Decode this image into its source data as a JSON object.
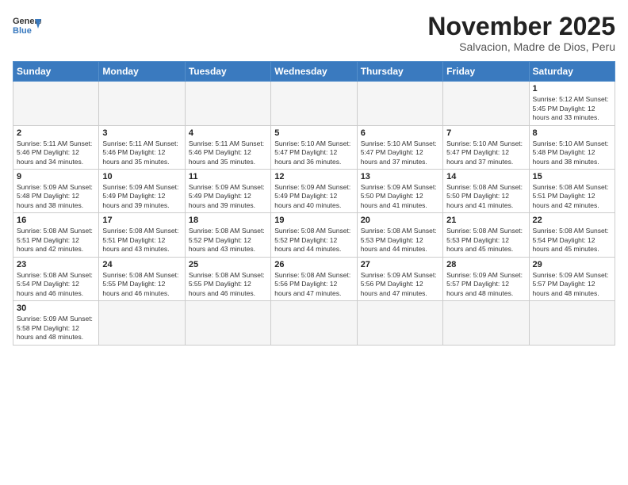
{
  "header": {
    "logo_line1": "General",
    "logo_line2": "Blue",
    "month": "November 2025",
    "location": "Salvacion, Madre de Dios, Peru"
  },
  "weekdays": [
    "Sunday",
    "Monday",
    "Tuesday",
    "Wednesday",
    "Thursday",
    "Friday",
    "Saturday"
  ],
  "weeks": [
    [
      {
        "day": "",
        "info": ""
      },
      {
        "day": "",
        "info": ""
      },
      {
        "day": "",
        "info": ""
      },
      {
        "day": "",
        "info": ""
      },
      {
        "day": "",
        "info": ""
      },
      {
        "day": "",
        "info": ""
      },
      {
        "day": "1",
        "info": "Sunrise: 5:12 AM\nSunset: 5:45 PM\nDaylight: 12 hours\nand 33 minutes."
      }
    ],
    [
      {
        "day": "2",
        "info": "Sunrise: 5:11 AM\nSunset: 5:46 PM\nDaylight: 12 hours\nand 34 minutes."
      },
      {
        "day": "3",
        "info": "Sunrise: 5:11 AM\nSunset: 5:46 PM\nDaylight: 12 hours\nand 35 minutes."
      },
      {
        "day": "4",
        "info": "Sunrise: 5:11 AM\nSunset: 5:46 PM\nDaylight: 12 hours\nand 35 minutes."
      },
      {
        "day": "5",
        "info": "Sunrise: 5:10 AM\nSunset: 5:47 PM\nDaylight: 12 hours\nand 36 minutes."
      },
      {
        "day": "6",
        "info": "Sunrise: 5:10 AM\nSunset: 5:47 PM\nDaylight: 12 hours\nand 37 minutes."
      },
      {
        "day": "7",
        "info": "Sunrise: 5:10 AM\nSunset: 5:47 PM\nDaylight: 12 hours\nand 37 minutes."
      },
      {
        "day": "8",
        "info": "Sunrise: 5:10 AM\nSunset: 5:48 PM\nDaylight: 12 hours\nand 38 minutes."
      }
    ],
    [
      {
        "day": "9",
        "info": "Sunrise: 5:09 AM\nSunset: 5:48 PM\nDaylight: 12 hours\nand 38 minutes."
      },
      {
        "day": "10",
        "info": "Sunrise: 5:09 AM\nSunset: 5:49 PM\nDaylight: 12 hours\nand 39 minutes."
      },
      {
        "day": "11",
        "info": "Sunrise: 5:09 AM\nSunset: 5:49 PM\nDaylight: 12 hours\nand 39 minutes."
      },
      {
        "day": "12",
        "info": "Sunrise: 5:09 AM\nSunset: 5:49 PM\nDaylight: 12 hours\nand 40 minutes."
      },
      {
        "day": "13",
        "info": "Sunrise: 5:09 AM\nSunset: 5:50 PM\nDaylight: 12 hours\nand 41 minutes."
      },
      {
        "day": "14",
        "info": "Sunrise: 5:08 AM\nSunset: 5:50 PM\nDaylight: 12 hours\nand 41 minutes."
      },
      {
        "day": "15",
        "info": "Sunrise: 5:08 AM\nSunset: 5:51 PM\nDaylight: 12 hours\nand 42 minutes."
      }
    ],
    [
      {
        "day": "16",
        "info": "Sunrise: 5:08 AM\nSunset: 5:51 PM\nDaylight: 12 hours\nand 42 minutes."
      },
      {
        "day": "17",
        "info": "Sunrise: 5:08 AM\nSunset: 5:51 PM\nDaylight: 12 hours\nand 43 minutes."
      },
      {
        "day": "18",
        "info": "Sunrise: 5:08 AM\nSunset: 5:52 PM\nDaylight: 12 hours\nand 43 minutes."
      },
      {
        "day": "19",
        "info": "Sunrise: 5:08 AM\nSunset: 5:52 PM\nDaylight: 12 hours\nand 44 minutes."
      },
      {
        "day": "20",
        "info": "Sunrise: 5:08 AM\nSunset: 5:53 PM\nDaylight: 12 hours\nand 44 minutes."
      },
      {
        "day": "21",
        "info": "Sunrise: 5:08 AM\nSunset: 5:53 PM\nDaylight: 12 hours\nand 45 minutes."
      },
      {
        "day": "22",
        "info": "Sunrise: 5:08 AM\nSunset: 5:54 PM\nDaylight: 12 hours\nand 45 minutes."
      }
    ],
    [
      {
        "day": "23",
        "info": "Sunrise: 5:08 AM\nSunset: 5:54 PM\nDaylight: 12 hours\nand 46 minutes."
      },
      {
        "day": "24",
        "info": "Sunrise: 5:08 AM\nSunset: 5:55 PM\nDaylight: 12 hours\nand 46 minutes."
      },
      {
        "day": "25",
        "info": "Sunrise: 5:08 AM\nSunset: 5:55 PM\nDaylight: 12 hours\nand 46 minutes."
      },
      {
        "day": "26",
        "info": "Sunrise: 5:08 AM\nSunset: 5:56 PM\nDaylight: 12 hours\nand 47 minutes."
      },
      {
        "day": "27",
        "info": "Sunrise: 5:09 AM\nSunset: 5:56 PM\nDaylight: 12 hours\nand 47 minutes."
      },
      {
        "day": "28",
        "info": "Sunrise: 5:09 AM\nSunset: 5:57 PM\nDaylight: 12 hours\nand 48 minutes."
      },
      {
        "day": "29",
        "info": "Sunrise: 5:09 AM\nSunset: 5:57 PM\nDaylight: 12 hours\nand 48 minutes."
      }
    ],
    [
      {
        "day": "30",
        "info": "Sunrise: 5:09 AM\nSunset: 5:58 PM\nDaylight: 12 hours\nand 48 minutes."
      },
      {
        "day": "",
        "info": ""
      },
      {
        "day": "",
        "info": ""
      },
      {
        "day": "",
        "info": ""
      },
      {
        "day": "",
        "info": ""
      },
      {
        "day": "",
        "info": ""
      },
      {
        "day": "",
        "info": ""
      }
    ]
  ]
}
